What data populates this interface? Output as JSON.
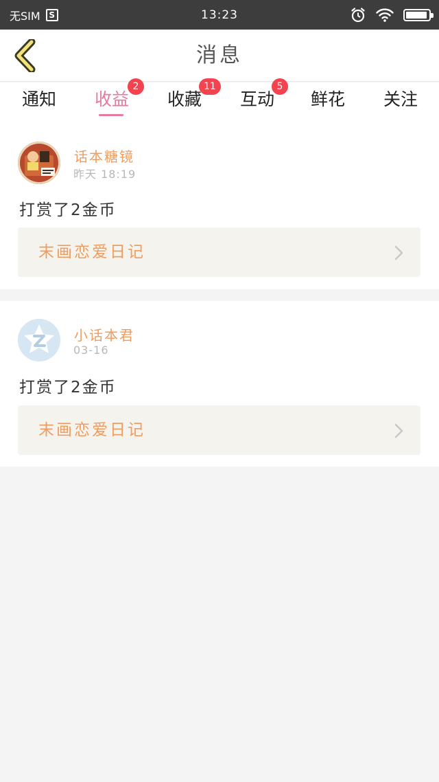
{
  "status_bar": {
    "carrier": "无SIM",
    "sim_icon_letter": "S",
    "time": "13:23"
  },
  "nav": {
    "title": "消息",
    "back_icon": "chevron-left-icon"
  },
  "tabs": [
    {
      "label": "通知",
      "badge": "",
      "active": false
    },
    {
      "label": "收益",
      "badge": "2",
      "active": true
    },
    {
      "label": "收藏",
      "badge": "11",
      "active": false
    },
    {
      "label": "互动",
      "badge": "5",
      "active": false
    },
    {
      "label": "鲜花",
      "badge": "",
      "active": false
    },
    {
      "label": "关注",
      "badge": "",
      "active": false
    }
  ],
  "messages": [
    {
      "user": "话本糖镜",
      "time": "昨天 18:19",
      "text": "打赏了2金币",
      "work": "末画恋爱日记"
    },
    {
      "user": "小话本君",
      "time": "03-16",
      "text": "打赏了2金币",
      "work": "末画恋爱日记"
    }
  ],
  "colors": {
    "accent_pink": "#e6799e",
    "badge_red": "#f2434f",
    "orange_text": "#f09c5e"
  }
}
